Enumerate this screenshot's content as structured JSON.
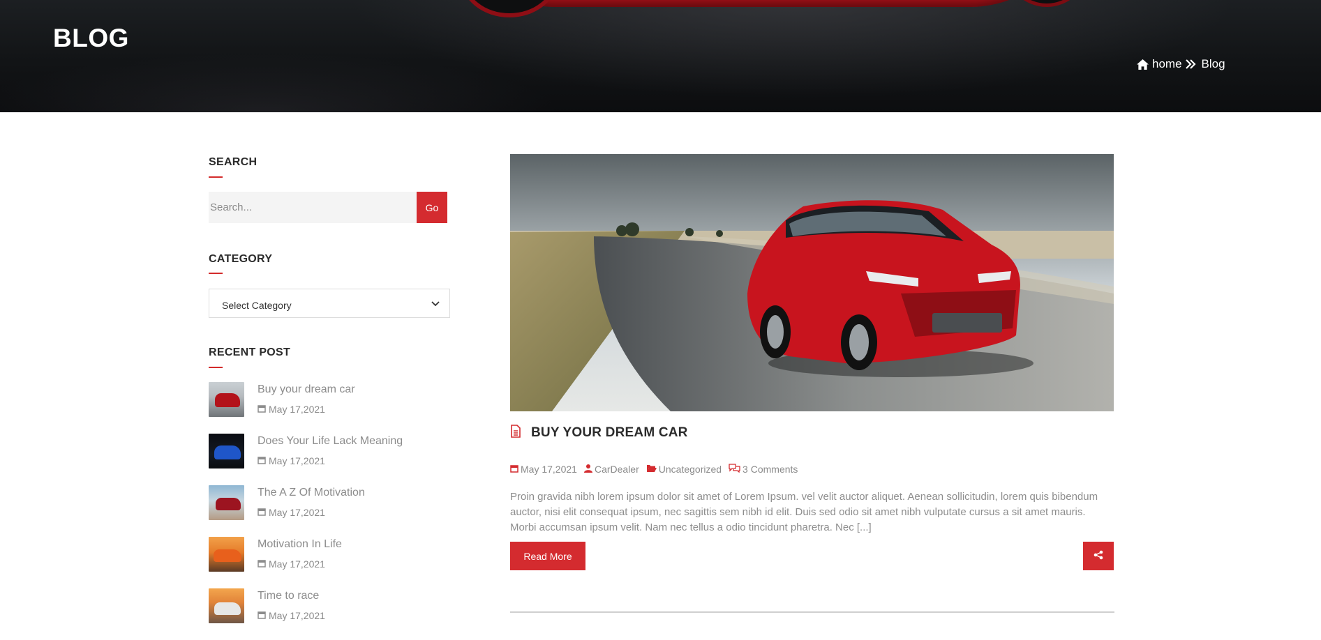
{
  "hero": {
    "title": "BLOG",
    "breadcrumb": {
      "home": "home",
      "current": "Blog"
    }
  },
  "sidebar": {
    "search": {
      "title": "SEARCH",
      "placeholder": "Search...",
      "button": "Go"
    },
    "category": {
      "title": "CATEGORY",
      "selected": "Select Category"
    },
    "recent": {
      "title": "RECENT POST",
      "items": [
        {
          "title": "Buy your dream car",
          "date": "May 17,2021"
        },
        {
          "title": "Does Your Life Lack Meaning",
          "date": "May 17,2021"
        },
        {
          "title": "The A Z Of Motivation",
          "date": "May 17,2021"
        },
        {
          "title": "Motivation In Life",
          "date": "May 17,2021"
        },
        {
          "title": "Time to race",
          "date": "May 17,2021"
        }
      ]
    }
  },
  "post": {
    "title": "BUY YOUR DREAM CAR",
    "meta": {
      "date": "May 17,2021",
      "author": "CarDealer",
      "category": "Uncategorized",
      "comments": "3 Comments"
    },
    "excerpt": "Proin gravida nibh lorem ipsum dolor sit amet of Lorem Ipsum. vel velit auctor aliquet. Aenean sollicitudin, lorem quis bibendum auctor, nisi elit consequat ipsum, nec sagittis sem nibh id elit. Duis sed odio sit amet nibh vulputate cursus a sit amet mauris. Morbi accumsan ipsum velit. Nam nec tellus a odio tincidunt pharetra. Nec [...]",
    "read_more": "Read More"
  },
  "colors": {
    "accent": "#d42b2f",
    "text_dark": "#2b2b2b",
    "text_muted": "#8c8c8c"
  }
}
